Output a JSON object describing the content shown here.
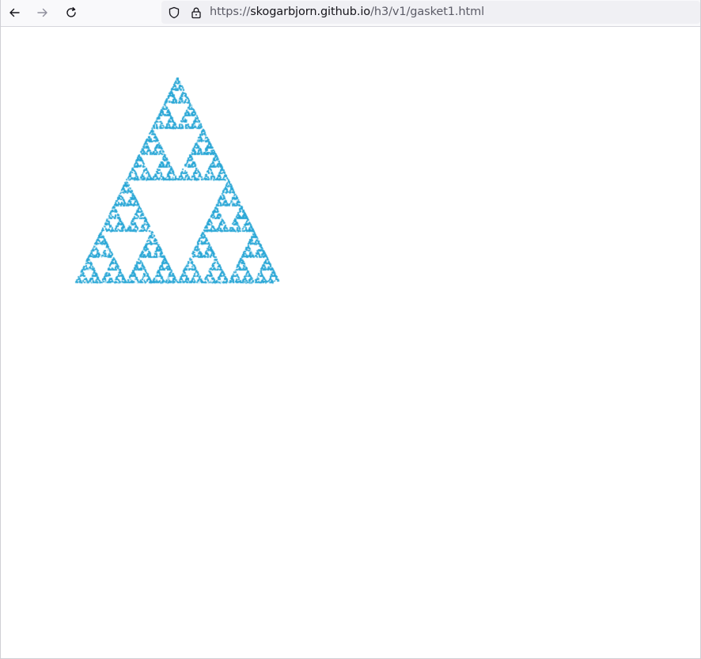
{
  "browser": {
    "back_icon": "arrow-left-icon",
    "forward_icon": "arrow-right-icon",
    "reload_icon": "reload-icon",
    "tracking_icon": "shield-icon",
    "security_icon": "lock-icon",
    "url": {
      "scheme": "https://",
      "host": "skogarbjorn.github.io",
      "path": "/h3/v1/gasket1.html"
    }
  },
  "page": {
    "figure": {
      "kind": "sierpinski-gasket",
      "color": "#2aa7d6",
      "background": "#ffffff"
    }
  }
}
